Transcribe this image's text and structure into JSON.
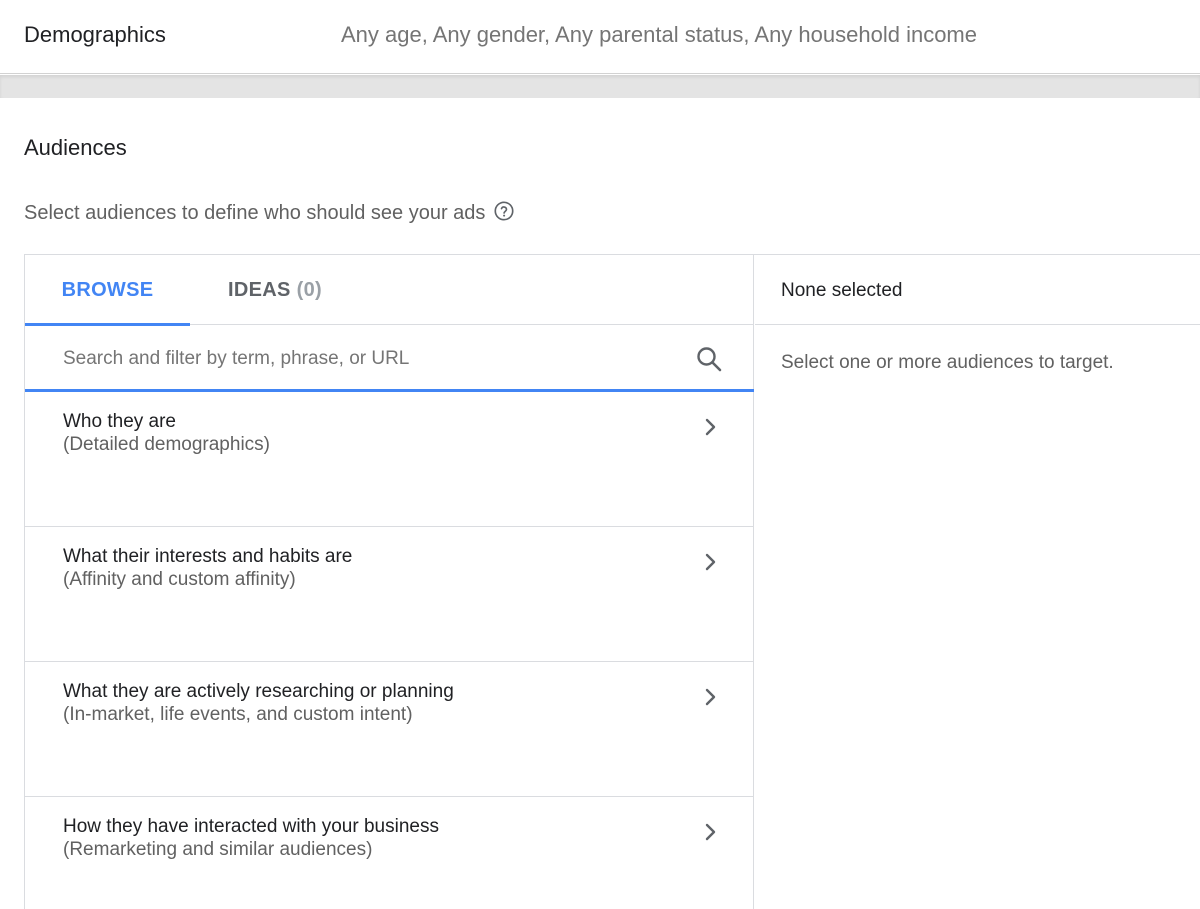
{
  "demographics": {
    "label": "Demographics",
    "value": "Any age, Any gender, Any parental status, Any household income"
  },
  "audiences": {
    "title": "Audiences",
    "subtitle": "Select audiences to define who should see your ads",
    "help_icon": "help-circle-icon"
  },
  "tabs": {
    "browse": "BROWSE",
    "ideas": "IDEAS",
    "ideas_count": "(0)"
  },
  "search": {
    "placeholder": "Search and filter by term, phrase, or URL",
    "value": ""
  },
  "categories": [
    {
      "title": "Who they are",
      "subtitle": "(Detailed demographics)"
    },
    {
      "title": "What their interests and habits are",
      "subtitle": "(Affinity and custom affinity)"
    },
    {
      "title": "What they are actively researching or planning",
      "subtitle": "(In-market, life events, and custom intent)"
    },
    {
      "title": "How they have interacted with your business",
      "subtitle": "(Remarketing and similar audiences)"
    }
  ],
  "selection": {
    "header": "None selected",
    "hint": "Select one or more audiences to target."
  },
  "colors": {
    "accent": "#4285f4",
    "border": "#dadce0",
    "band": "#e4e4e4"
  }
}
